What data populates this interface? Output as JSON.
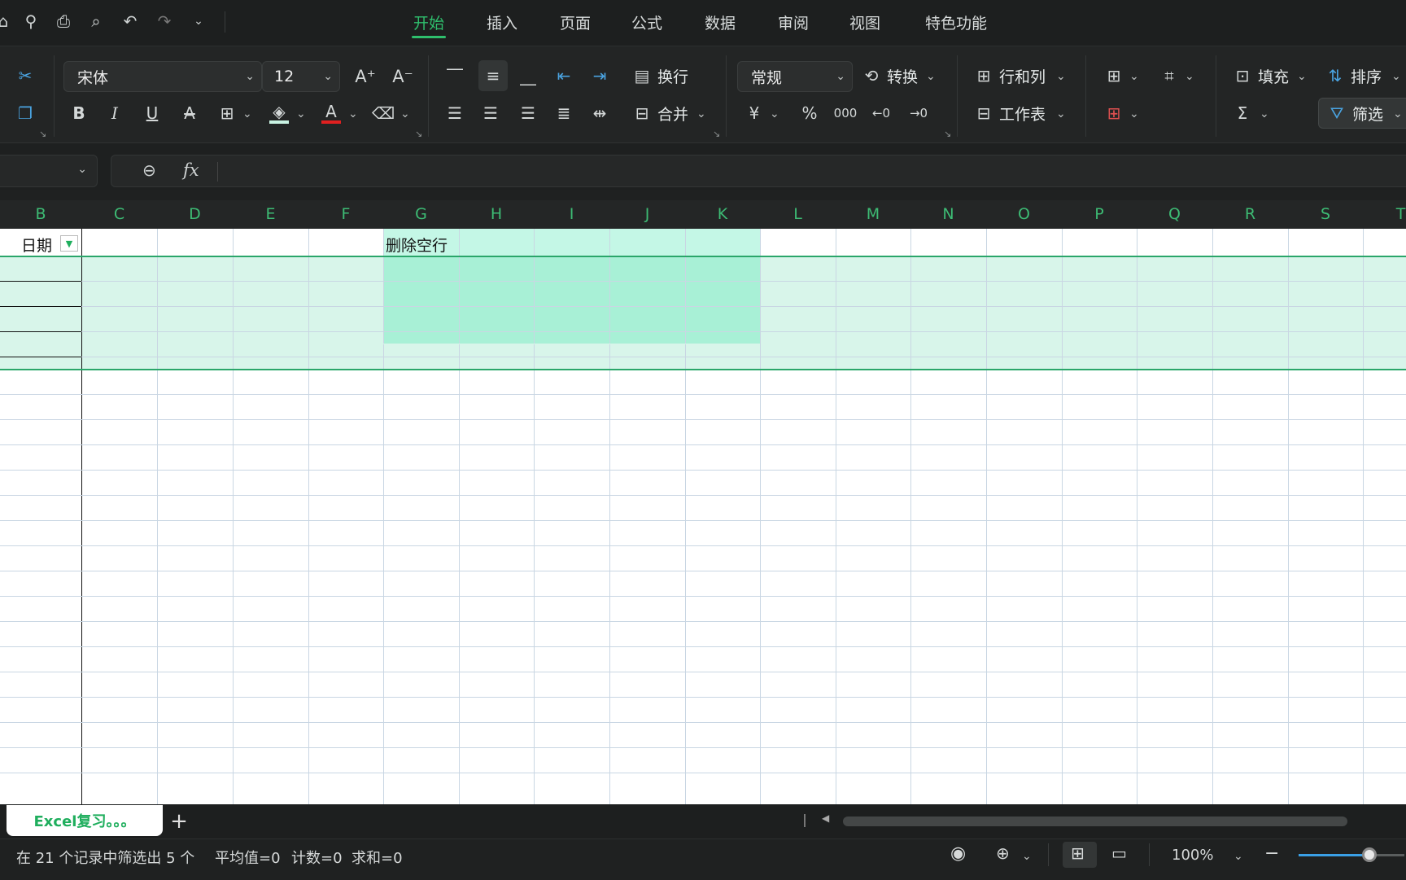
{
  "top_tabs": [
    "开始",
    "插入",
    "页面",
    "公式",
    "数据",
    "审阅",
    "视图",
    "特色功能"
  ],
  "active_tab": "开始",
  "ribbon": {
    "font_name": "宋体",
    "font_size": "12",
    "wrap_label": "换行",
    "merge_label": "合并",
    "number_format": "常规",
    "convert_label": "转换",
    "rows_cols_label": "行和列",
    "worksheet_label": "工作表",
    "fill_label": "填充",
    "sort_label": "排序",
    "filter_label": "筛选",
    "yuan_symbol": "¥"
  },
  "formula_bar": {
    "fx_label": "fx",
    "content": ""
  },
  "columns": [
    "B",
    "C",
    "D",
    "E",
    "F",
    "G",
    "H",
    "I",
    "J",
    "K",
    "L",
    "M",
    "N",
    "O",
    "P",
    "Q",
    "R",
    "S",
    "T"
  ],
  "cells": {
    "b_header": "日期",
    "g_header": "删除空行"
  },
  "sheet_tab": "Excel复习。。。",
  "status": {
    "filter_info": "在 21 个记录中筛选出 5 个",
    "average": "平均值=0",
    "count": "计数=0",
    "sum": "求和=0",
    "zoom": "100%"
  },
  "colors": {
    "accent": "#2fbf6d",
    "selection_fill": "#d8f5ea",
    "selection_strong": "#a8f0d6",
    "header_green": "#3dbb74"
  }
}
